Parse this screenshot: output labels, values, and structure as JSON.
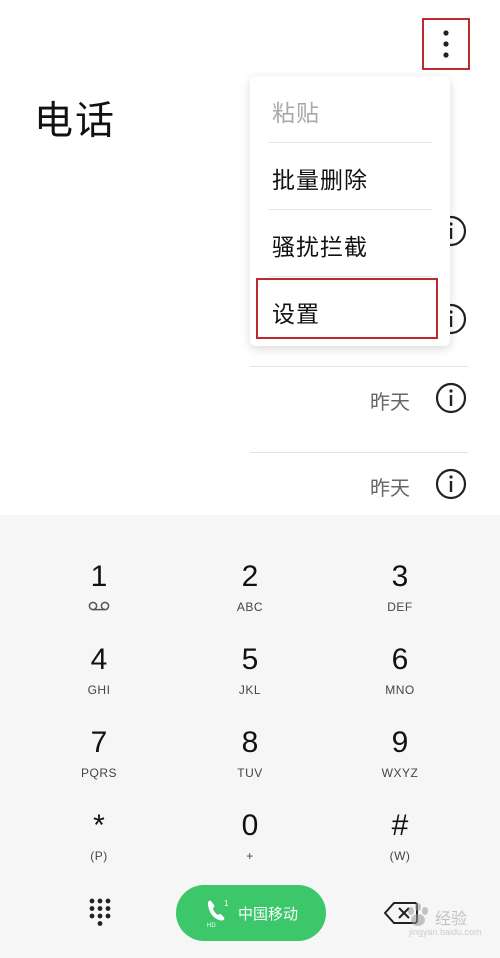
{
  "header": {
    "title": "电话",
    "more_icon": "more-vert-icon"
  },
  "menu": {
    "items": [
      {
        "label": "粘贴",
        "enabled": false
      },
      {
        "label": "批量删除",
        "enabled": true
      },
      {
        "label": "骚扰拦截",
        "enabled": true
      },
      {
        "label": "设置",
        "enabled": true,
        "highlighted": true
      }
    ]
  },
  "call_log": {
    "rows": [
      {
        "time": "昨天"
      },
      {
        "time": "昨天"
      }
    ]
  },
  "keypad": {
    "keys": [
      {
        "digit": "1",
        "letters": ""
      },
      {
        "digit": "2",
        "letters": "ABC"
      },
      {
        "digit": "3",
        "letters": "DEF"
      },
      {
        "digit": "4",
        "letters": "GHI"
      },
      {
        "digit": "5",
        "letters": "JKL"
      },
      {
        "digit": "6",
        "letters": "MNO"
      },
      {
        "digit": "7",
        "letters": "PQRS"
      },
      {
        "digit": "8",
        "letters": "TUV"
      },
      {
        "digit": "9",
        "letters": "WXYZ"
      },
      {
        "digit": "*",
        "letters": "(P)"
      },
      {
        "digit": "0",
        "letters": "+"
      },
      {
        "digit": "#",
        "letters": "(W)"
      }
    ],
    "call_button": {
      "carrier": "中国移动",
      "sim": "1",
      "badge": "HD"
    }
  },
  "watermark": {
    "text": "经验",
    "url": "jingyan.baidu.com"
  },
  "colors": {
    "accent_green": "#3bc76a",
    "highlight_red": "#c0282f"
  }
}
